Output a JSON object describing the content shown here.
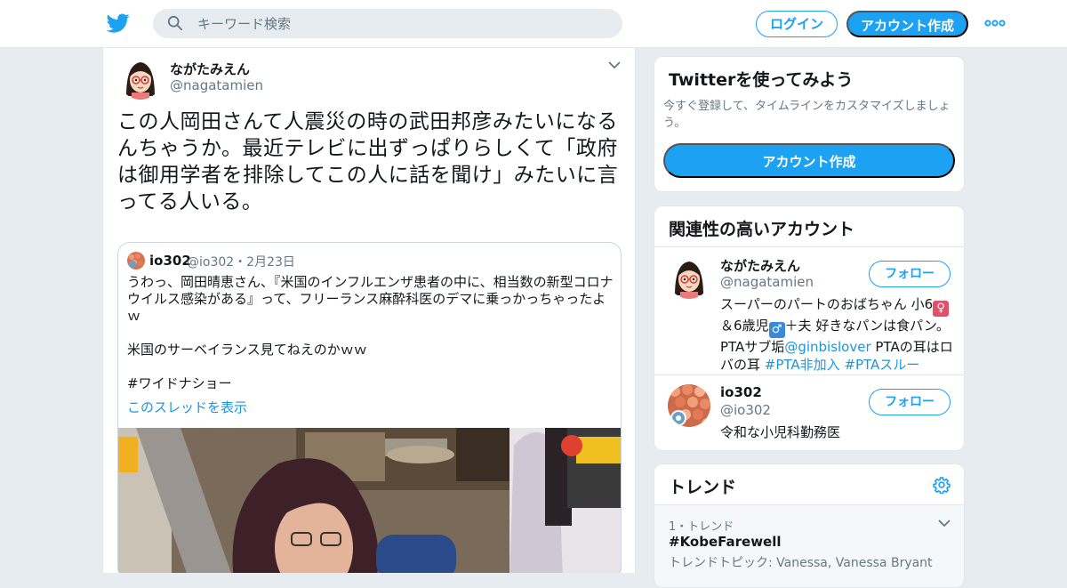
{
  "header": {
    "search_placeholder": "キーワード検索",
    "login_label": "ログイン",
    "signup_label": "アカウント作成",
    "brand_color": "#1da1f2"
  },
  "tweet": {
    "author_name": "ながたみえん",
    "author_handle": "@nagatamien",
    "text": "この人岡田さんて人震災の時の武田邦彦みたいになるんちゃうか。最近テレビに出ずっぱりらしくて「政府は御用学者を排除してこの人に話を聞け」みたいに言ってる人いる。",
    "quote": {
      "name": "io302",
      "meta": "@io302・2月23日",
      "text": "うわっ、岡田晴恵さん、『米国のインフルエンザ患者の中に、相当数の新型コロナウイルス感染がある』って、フリーランス麻酔科医のデマに乗っかっちゃったよｗ\n\n米国のサーベイランス見てねえのかｗｗ\n\n#ワイドナショー",
      "thread_link": "このスレッドを表示"
    }
  },
  "sidebar": {
    "signup": {
      "title": "Twitterを使ってみよう",
      "description": "今すぐ登録して、タイムラインをカスタマイズしましょう。",
      "button_label": "アカウント作成"
    },
    "related": {
      "title": "関連性の高いアカウント",
      "follow_label": "フォロー",
      "accounts": [
        {
          "name": "ながたみえん",
          "handle": "@nagatamien",
          "bio_1": "スーパーのパートのおばちゃん 小6",
          "bio_2": "＆6歳児",
          "bio_3": "＋夫 好きなパンは食パン。PTAサブ垢",
          "bio_link": "@ginbislover",
          "bio_4": " PTAの耳はロバの耳 ",
          "hashtag_1": "#PTA非加入",
          "hashtag_2": "#PTAスルー"
        },
        {
          "name": "io302",
          "handle": "@io302",
          "bio": "令和な小児科勤務医"
        }
      ]
    },
    "trends": {
      "title": "トレンド",
      "items": [
        {
          "rank": "1・トレンド",
          "name": "#KobeFarewell",
          "topic": "トレンドトピック: Vanessa, Vanessa Bryant"
        }
      ]
    }
  }
}
